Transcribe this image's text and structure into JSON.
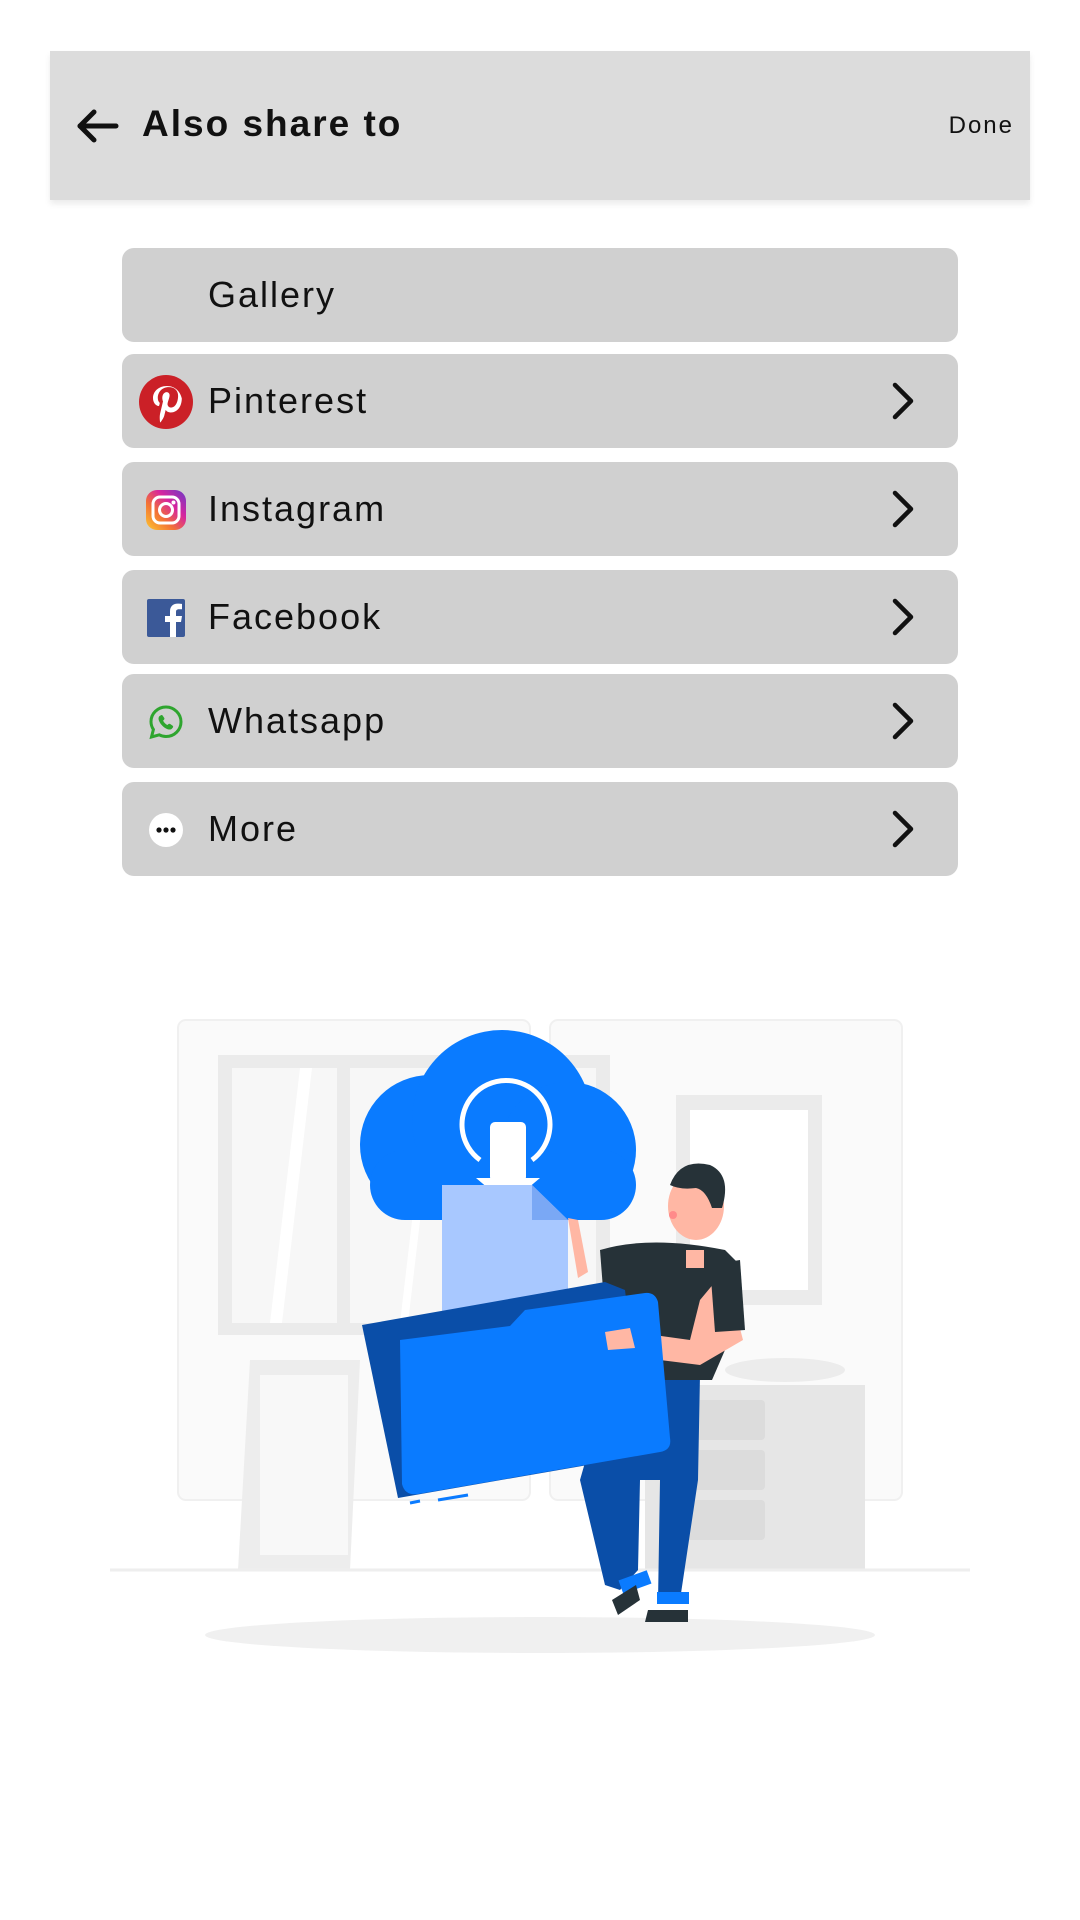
{
  "header": {
    "title": "Also share to",
    "done_label": "Done"
  },
  "share_options": [
    {
      "label": "Gallery",
      "icon": "none",
      "has_chevron": false
    },
    {
      "label": "Pinterest",
      "icon": "pinterest-icon",
      "has_chevron": true
    },
    {
      "label": "Instagram",
      "icon": "instagram-icon",
      "has_chevron": true
    },
    {
      "label": "Facebook",
      "icon": "facebook-icon",
      "has_chevron": true
    },
    {
      "label": "Whatsapp",
      "icon": "whatsapp-icon",
      "has_chevron": true
    },
    {
      "label": "More",
      "icon": "more-icon",
      "has_chevron": true
    }
  ],
  "colors": {
    "header_bg": "#dcdcdc",
    "item_bg": "#d0d0d0",
    "pinterest": "#cb2027",
    "facebook": "#3b5998",
    "whatsapp": "#2fa52f",
    "accent_blue": "#0a7bff"
  }
}
